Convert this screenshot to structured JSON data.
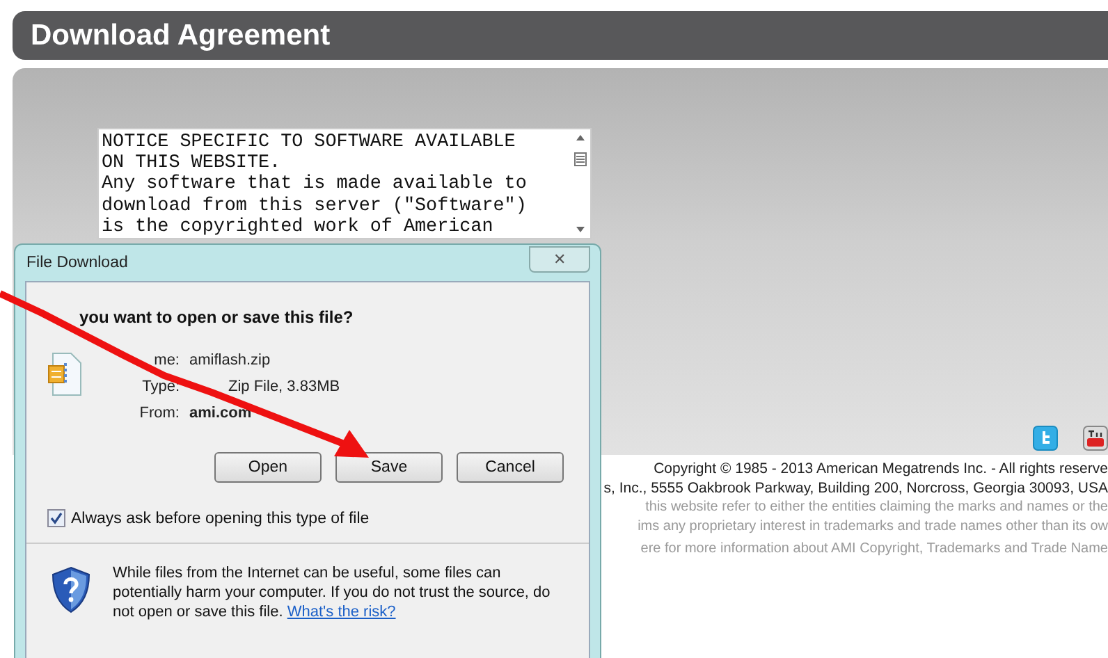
{
  "page": {
    "title": "Download Agreement",
    "agreement_lines": [
      "NOTICE SPECIFIC TO SOFTWARE AVAILABLE",
      "ON THIS WEBSITE.",
      "Any software that is made available to",
      "download from this server (\"Software\")",
      "is the copyrighted work of American"
    ],
    "footer_lines": [
      {
        "text": "Copyright © 1985 - 2013 American Megatrends Inc. - All rights reserve",
        "kind": "dark"
      },
      {
        "text": "s, Inc., 5555 Oakbrook Parkway, Building 200, Norcross, Georgia 30093, USA",
        "kind": "dark"
      },
      {
        "text": "this website refer to either the entities claiming the marks and names or the",
        "kind": "muted"
      },
      {
        "text": "ims any proprietary interest in trademarks and trade names other than its ow",
        "kind": "muted"
      },
      {
        "text": "ere for more information about AMI Copyright, Trademarks and Trade Name",
        "kind": "muted"
      }
    ]
  },
  "dialog": {
    "title": "File Download",
    "close": "✕",
    "question": "you want to open or save this file?",
    "fields": [
      {
        "label": "me:",
        "value": "amiflash.zip",
        "bold": false,
        "kind": "plain"
      },
      {
        "label": "Type:",
        "value": "Zip File, 3.83MB",
        "bold": false,
        "kind": "covered"
      },
      {
        "label": "From:",
        "value": "ami.com",
        "bold": true,
        "kind": "plain"
      }
    ],
    "buttons": [
      "Open",
      "Save",
      "Cancel"
    ],
    "checkbox": {
      "label": "Always ask before opening this type of file",
      "checked": true
    },
    "warning": "While files from the Internet can be useful, some files can potentially harm your computer. If you do not trust the source, do not open or save this file.",
    "risk_link": "What's the risk?"
  }
}
